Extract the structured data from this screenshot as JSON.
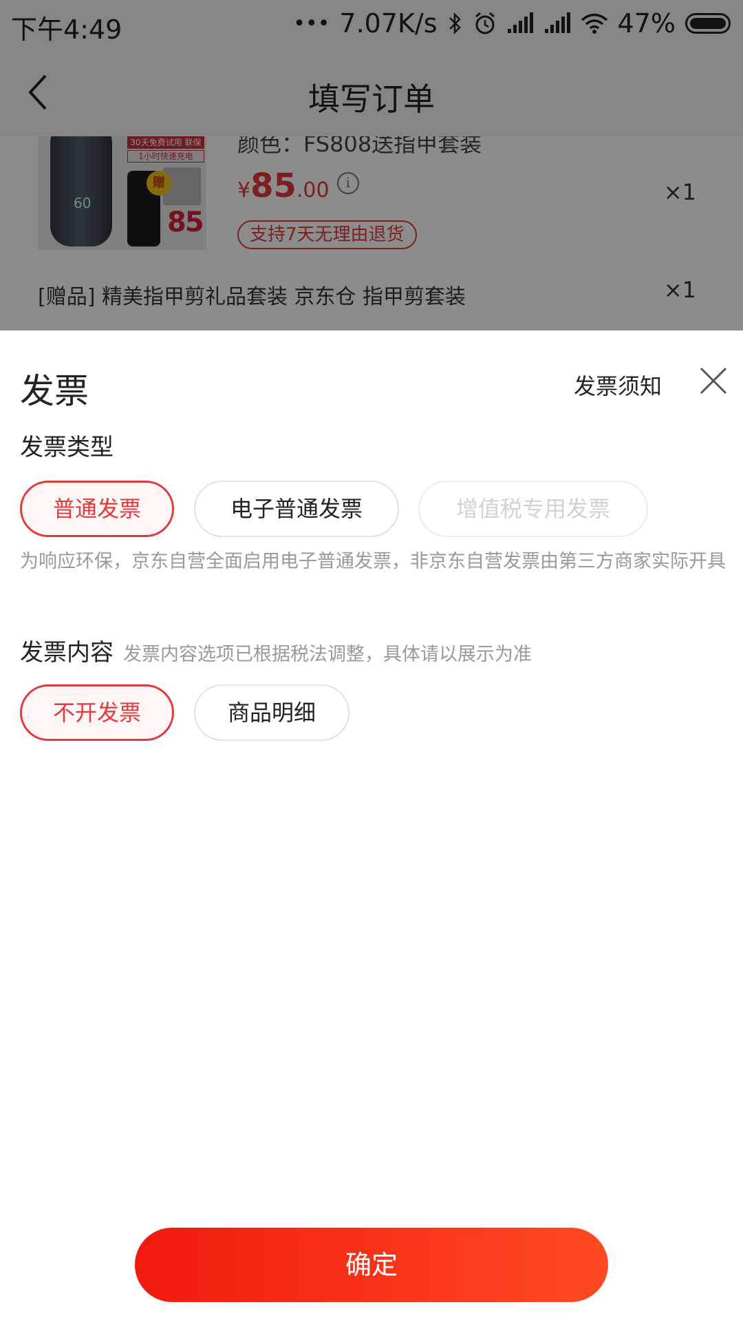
{
  "status_bar": {
    "time": "下午4:49",
    "net_speed": "7.07K/s",
    "battery": "47%"
  },
  "nav": {
    "title": "填写订单"
  },
  "product": {
    "color_label": "颜色：FS808送指甲套装",
    "price_symbol": "¥",
    "price_int": "85",
    "price_dec": ".00",
    "quantity": "×1",
    "return_policy": "支持7天无理由退货",
    "image_texts": {
      "tag1": "30天免费试用 联保",
      "tag2": "1小时快速充电",
      "gift": "赠",
      "price": "85",
      "screen": "60"
    },
    "gift_line": "[赠品]  精美指甲剪礼品套装  京东仓 指甲剪套装",
    "gift_quantity": "×1"
  },
  "sheet": {
    "title": "发票",
    "notice_link": "发票须知",
    "invoice_type": {
      "label": "发票类型",
      "options": [
        {
          "label": "普通发票",
          "state": "selected"
        },
        {
          "label": "电子普通发票",
          "state": "normal"
        },
        {
          "label": "增值税专用发票",
          "state": "disabled"
        }
      ],
      "tip": "为响应环保，京东自营全面启用电子普通发票，非京东自营发票由第三方商家实际开具"
    },
    "invoice_content": {
      "label": "发票内容",
      "hint": "发票内容选项已根据税法调整，具体请以展示为准",
      "options": [
        {
          "label": "不开发票",
          "state": "selected"
        },
        {
          "label": "商品明细",
          "state": "normal"
        }
      ]
    },
    "confirm": "确定"
  },
  "colors": {
    "accent": "#e4393c",
    "button_start": "#f01a0e",
    "button_end": "#ff4a22"
  }
}
